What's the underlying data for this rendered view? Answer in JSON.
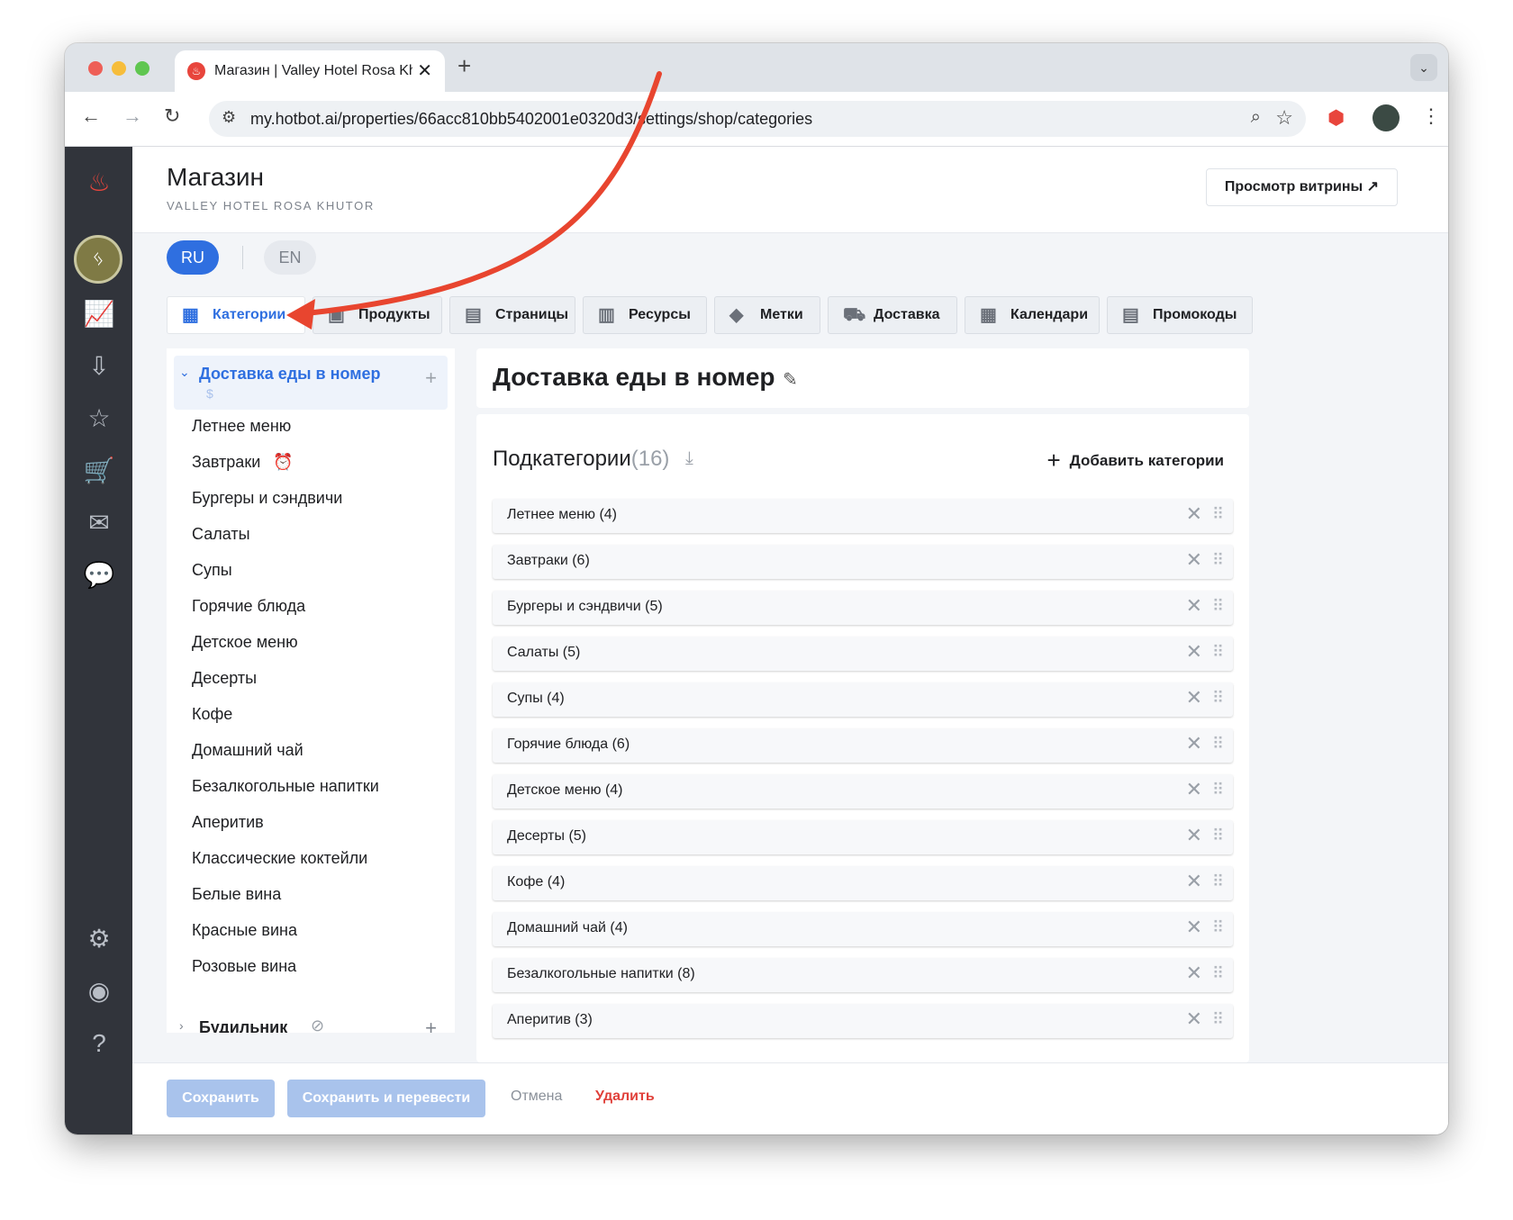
{
  "browser": {
    "tab_title": "Магазин | Valley Hotel Rosa Khutor",
    "url": "my.hotbot.ai/properties/66acc810bb5402001e0320d3/settings/shop/categories"
  },
  "header": {
    "title": "Магазин",
    "subtitle": "VALLEY HOTEL ROSA KHUTOR",
    "storefront_button": "Просмотр витрины ↗"
  },
  "languages": [
    {
      "code": "RU",
      "active": true
    },
    {
      "code": "EN",
      "active": false
    }
  ],
  "tabs": [
    {
      "label": "Категории",
      "icon": "store-icon",
      "active": true
    },
    {
      "label": "Продукты",
      "icon": "gift-icon"
    },
    {
      "label": "Страницы",
      "icon": "document-icon"
    },
    {
      "label": "Ресурсы",
      "icon": "resources-icon"
    },
    {
      "label": "Метки",
      "icon": "tag-icon"
    },
    {
      "label": "Доставка",
      "icon": "truck-icon"
    },
    {
      "label": "Календари",
      "icon": "calendar-icon"
    },
    {
      "label": "Промокоды",
      "icon": "promo-icon"
    }
  ],
  "tree": {
    "root": {
      "label": "Доставка еды в номер",
      "badge": "$"
    },
    "items": [
      "Летнее меню",
      "Завтраки",
      "Бургеры и сэндвичи",
      "Салаты",
      "Супы",
      "Горячие блюда",
      "Детское меню",
      "Десерты",
      "Кофе",
      "Домашний чай",
      "Безалкогольные напитки",
      "Аперитив",
      "Классические коктейли",
      "Белые вина",
      "Красные вина",
      "Розовые вина"
    ],
    "second_root": {
      "label": "Будильник"
    }
  },
  "content": {
    "title": "Доставка еды в номер",
    "subcategories_label": "Подкатегории",
    "subcategories_count": "(16)",
    "add_button": "Добавить категории",
    "rows": [
      "Летнее меню (4)",
      "Завтраки (6)",
      "Бургеры и сэндвичи (5)",
      "Салаты (5)",
      "Супы (4)",
      "Горячие блюда (6)",
      "Детское меню (4)",
      "Десерты (5)",
      "Кофе (4)",
      "Домашний чай (4)",
      "Безалкогольные напитки (8)",
      "Аперитив (3)"
    ]
  },
  "footer": {
    "save": "Сохранить",
    "save_translate": "Сохранить и перевести",
    "cancel": "Отмена",
    "delete": "Удалить"
  },
  "colors": {
    "accent": "#2f6fe0",
    "danger": "#e0403a",
    "sidebar": "#31343b",
    "arrow": "#e8452f"
  }
}
